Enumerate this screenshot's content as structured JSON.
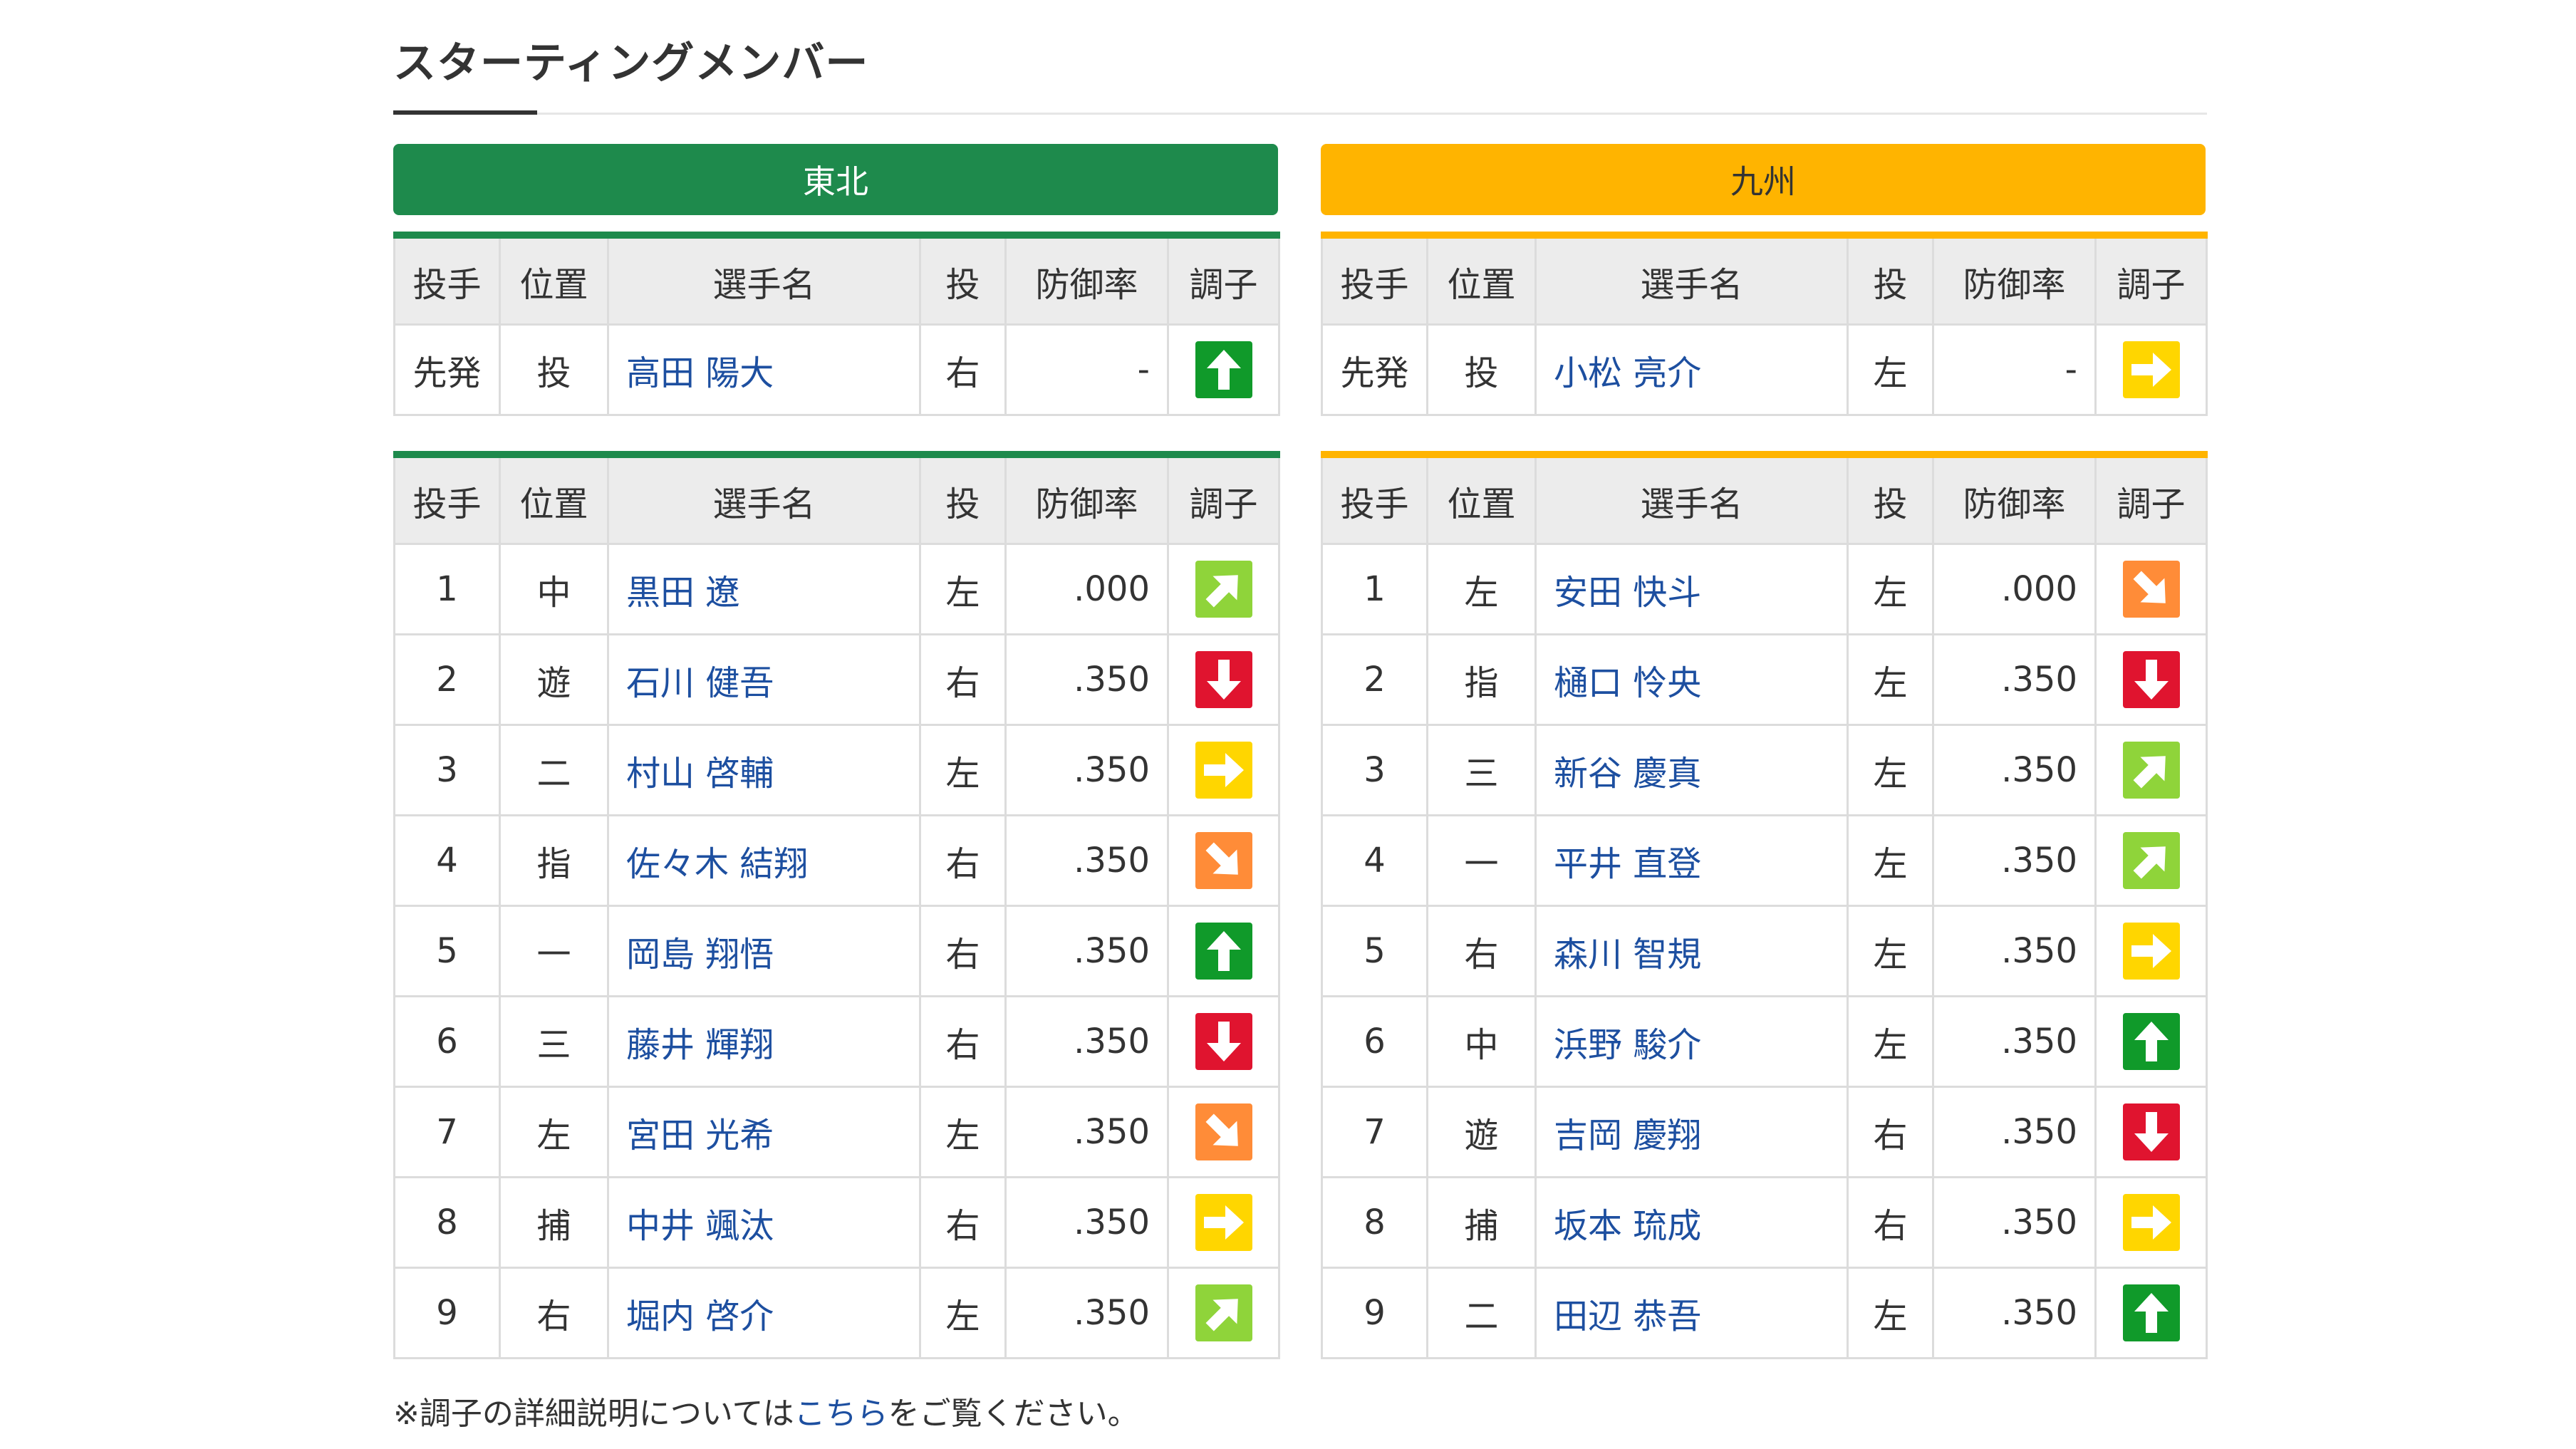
{
  "section_title": "スターティングメンバー",
  "colors": {
    "home": "#1e8a4c",
    "away": "#ffb400",
    "link": "#1d4fa0",
    "cond_up": "#109a2a",
    "cond_upright": "#8fd43a",
    "cond_right": "#ffd600",
    "cond_downright": "#ff8c38",
    "cond_down": "#e0142f"
  },
  "headers": [
    "投手",
    "位置",
    "選手名",
    "投",
    "防御率",
    "調子"
  ],
  "teams": [
    {
      "name": "東北",
      "pitcher": {
        "order": "先発",
        "pos": "投",
        "name": "高田 陽大",
        "hand": "右",
        "era": "-",
        "cond": "up-icon"
      },
      "lineup": [
        {
          "order": "1",
          "pos": "中",
          "name": "黒田 遼",
          "hand": "左",
          "era": ".000",
          "cond": "upright-icon"
        },
        {
          "order": "2",
          "pos": "遊",
          "name": "石川 健吾",
          "hand": "右",
          "era": ".350",
          "cond": "down-icon"
        },
        {
          "order": "3",
          "pos": "二",
          "name": "村山 啓輔",
          "hand": "左",
          "era": ".350",
          "cond": "right-icon"
        },
        {
          "order": "4",
          "pos": "指",
          "name": "佐々木 結翔",
          "hand": "右",
          "era": ".350",
          "cond": "downright-icon"
        },
        {
          "order": "5",
          "pos": "一",
          "name": "岡島 翔悟",
          "hand": "右",
          "era": ".350",
          "cond": "up-icon"
        },
        {
          "order": "6",
          "pos": "三",
          "name": "藤井 輝翔",
          "hand": "右",
          "era": ".350",
          "cond": "down-icon"
        },
        {
          "order": "7",
          "pos": "左",
          "name": "宮田 光希",
          "hand": "左",
          "era": ".350",
          "cond": "downright-icon"
        },
        {
          "order": "8",
          "pos": "捕",
          "name": "中井 颯汰",
          "hand": "右",
          "era": ".350",
          "cond": "right-icon"
        },
        {
          "order": "9",
          "pos": "右",
          "name": "堀内 啓介",
          "hand": "左",
          "era": ".350",
          "cond": "upright-icon"
        }
      ]
    },
    {
      "name": "九州",
      "pitcher": {
        "order": "先発",
        "pos": "投",
        "name": "小松 亮介",
        "hand": "左",
        "era": "-",
        "cond": "right-icon"
      },
      "lineup": [
        {
          "order": "1",
          "pos": "左",
          "name": "安田 快斗",
          "hand": "左",
          "era": ".000",
          "cond": "downright-icon"
        },
        {
          "order": "2",
          "pos": "指",
          "name": "樋口 怜央",
          "hand": "左",
          "era": ".350",
          "cond": "down-icon"
        },
        {
          "order": "3",
          "pos": "三",
          "name": "新谷 慶真",
          "hand": "左",
          "era": ".350",
          "cond": "upright-icon"
        },
        {
          "order": "4",
          "pos": "一",
          "name": "平井 直登",
          "hand": "左",
          "era": ".350",
          "cond": "upright-icon"
        },
        {
          "order": "5",
          "pos": "右",
          "name": "森川 智規",
          "hand": "左",
          "era": ".350",
          "cond": "right-icon"
        },
        {
          "order": "6",
          "pos": "中",
          "name": "浜野 駿介",
          "hand": "左",
          "era": ".350",
          "cond": "up-icon"
        },
        {
          "order": "7",
          "pos": "遊",
          "name": "吉岡 慶翔",
          "hand": "右",
          "era": ".350",
          "cond": "down-icon"
        },
        {
          "order": "8",
          "pos": "捕",
          "name": "坂本 琉成",
          "hand": "右",
          "era": ".350",
          "cond": "right-icon"
        },
        {
          "order": "9",
          "pos": "二",
          "name": "田辺 恭吾",
          "hand": "左",
          "era": ".350",
          "cond": "up-icon"
        }
      ]
    }
  ],
  "note": {
    "prefix": "※調子の詳細説明については",
    "link": "こちら",
    "suffix": "をご覧ください。"
  }
}
